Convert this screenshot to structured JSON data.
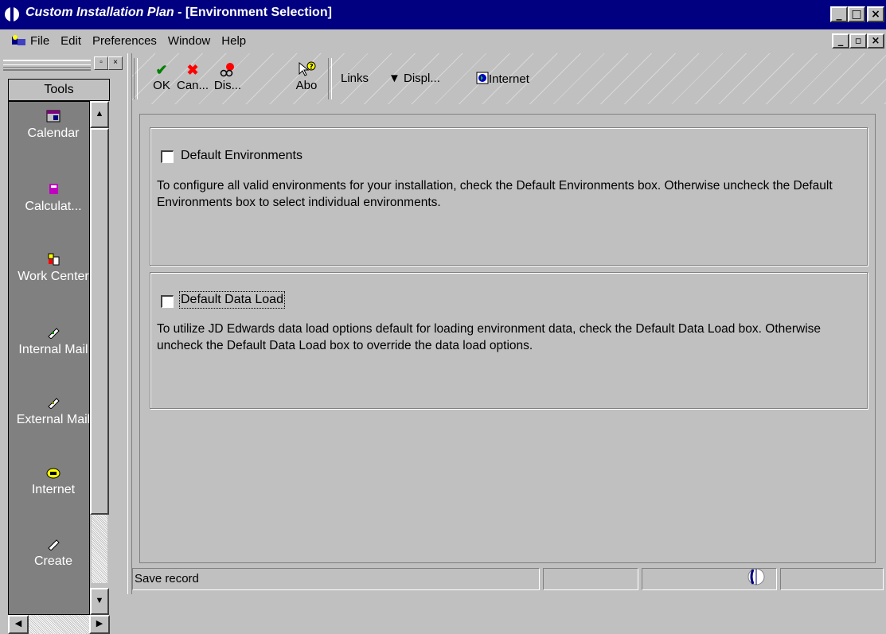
{
  "window": {
    "title_italic": "Custom Installation Plan",
    "title_rest": " - [Environment Selection]",
    "caption_buttons": [
      "_",
      "□",
      "×"
    ]
  },
  "menubar": {
    "items": [
      "File",
      "Edit",
      "Preferences",
      "Window",
      "Help"
    ],
    "mdi_buttons": [
      "_",
      "▫",
      "×"
    ]
  },
  "tools_panel": {
    "header": "Tools",
    "items": [
      {
        "label": "Calendar",
        "icon": "calendar-icon"
      },
      {
        "label": "Calculat...",
        "icon": "calculator-icon"
      },
      {
        "label": "Work Center",
        "icon": "work-center-icon"
      },
      {
        "label": "Internal Mail",
        "icon": "internal-mail-icon"
      },
      {
        "label": "External Mail",
        "icon": "external-mail-icon"
      },
      {
        "label": "Internet",
        "icon": "telephone-icon"
      },
      {
        "label": "Create",
        "icon": "create-icon"
      }
    ]
  },
  "toolbar": {
    "ok": "OK",
    "cancel": "Can...",
    "display": "Dis...",
    "about": "Abo",
    "links": "Links",
    "display_menu": "Displ...",
    "internet": "Internet"
  },
  "content": {
    "default_environments": {
      "label": "Default Environments",
      "checked": false,
      "description": "To configure all valid environments for your installation, check the Default Environments box.  Otherwise uncheck the Default Environments box to select individual environments."
    },
    "default_data_load": {
      "label": "Default Data Load",
      "checked": false,
      "description": "To utilize JD Edwards data load options default for loading environment data, check the Default Data Load box.  Otherwise uncheck the Default Data Load box to override the data load options."
    }
  },
  "statusbar": {
    "message": "Save record"
  },
  "colors": {
    "title_bar": "#000080",
    "face": "#c0c0c0",
    "tools_bg": "#808080",
    "ok_green": "#008000",
    "cancel_red": "#ff0000"
  }
}
